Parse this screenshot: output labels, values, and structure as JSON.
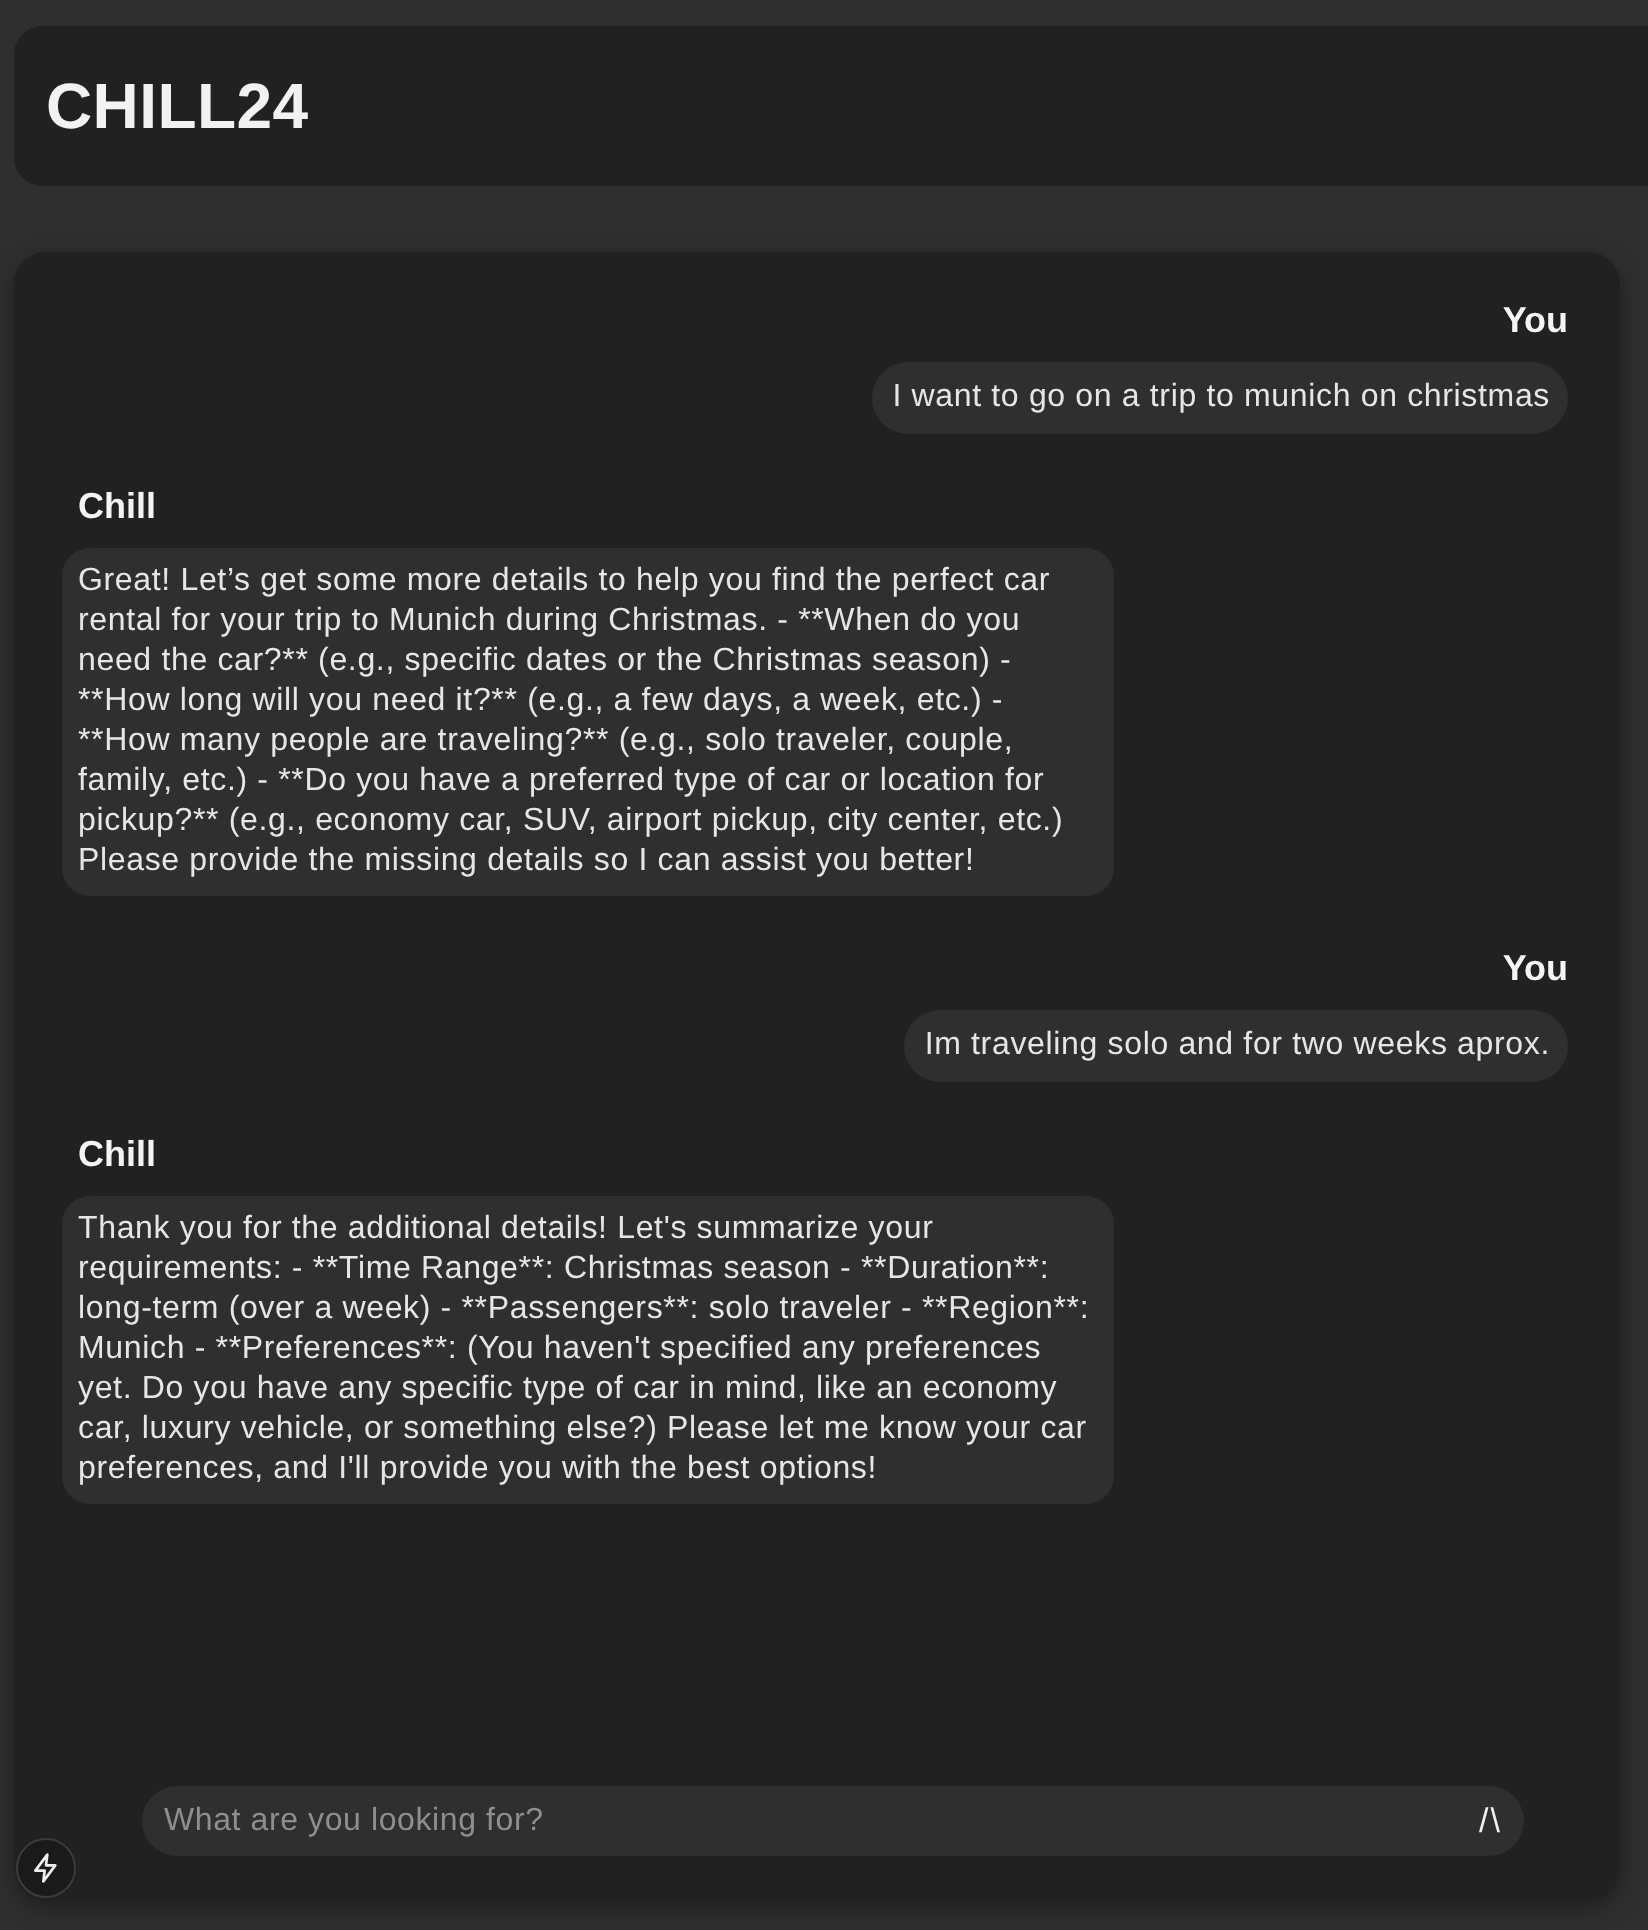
{
  "header": {
    "title": "CHILL24"
  },
  "messages": [
    {
      "kind": "user",
      "sender": "You",
      "text": "I want to go on a trip to munich on christmas"
    },
    {
      "kind": "assistant",
      "sender": "Chill",
      "text": "Great! Let’s get some more details to help you find the perfect car rental for your trip to Munich during Christmas. - **When do you need the car?** (e.g., specific dates or the Christmas season) - **How long will you need it?** (e.g., a few days, a week, etc.) - **How many people are traveling?** (e.g., solo traveler, couple, family, etc.) - **Do you have a preferred type of car or location for pickup?** (e.g., economy car, SUV, airport pickup, city center, etc.) Please provide the missing details so I can assist you better!"
    },
    {
      "kind": "user",
      "sender": "You",
      "text": "Im traveling solo and for two weeks aprox."
    },
    {
      "kind": "assistant",
      "sender": "Chill",
      "text": "Thank you for the additional details! Let's summarize your requirements: - **Time Range**: Christmas season - **Duration**: long-term (over a week) - **Passengers**: solo traveler - **Region**: Munich - **Preferences**: (You haven't specified any preferences yet. Do you have any specific type of car in mind, like an economy car, luxury vehicle, or something else?) Please let me know your car preferences, and I'll provide you with the best options!"
    }
  ],
  "input": {
    "placeholder": "What are you looking for?",
    "send_label": "/\\"
  }
}
